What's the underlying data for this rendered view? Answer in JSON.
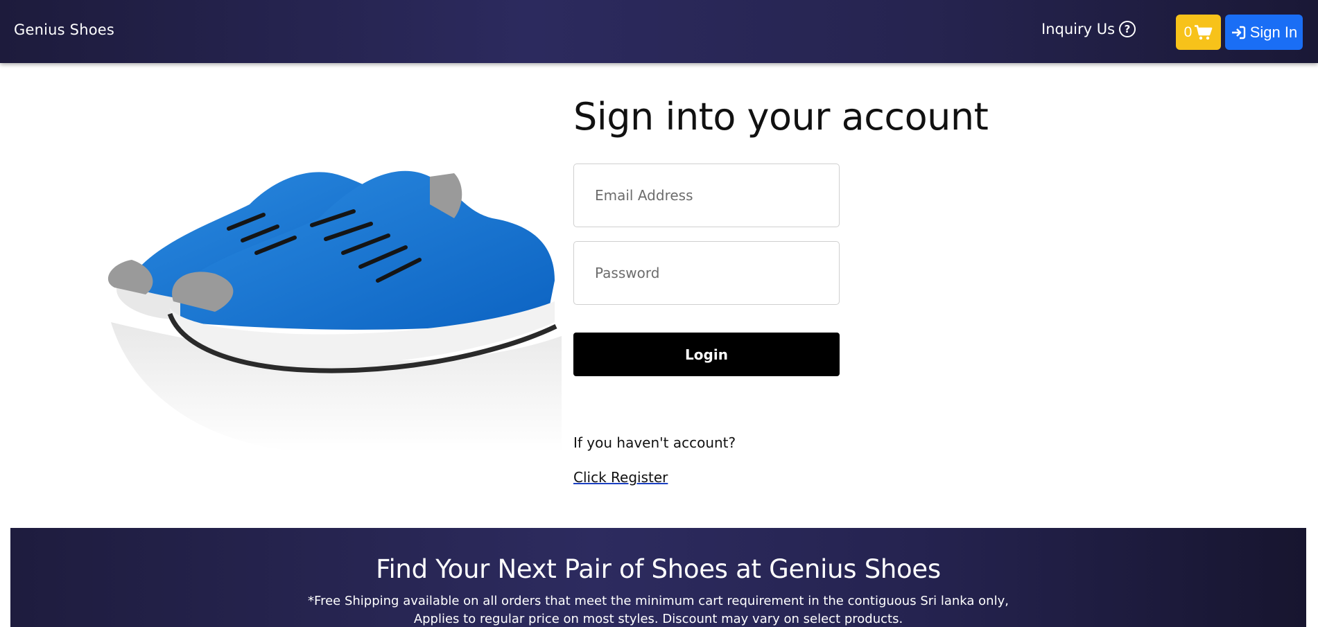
{
  "navbar": {
    "brand": "Genius Shoes",
    "inquiry_label": "Inquiry Us",
    "cart_count": "0",
    "signin_label": "Sign In",
    "colors": {
      "cart": "#f7c21a",
      "signin": "#1a6ef5",
      "nav_bg": "#2c2a5e"
    }
  },
  "login": {
    "title": "Sign into your account",
    "email_placeholder": "Email Address",
    "password_placeholder": "Password",
    "login_label": "Login",
    "no_account_text": "If you haven't account?",
    "register_link": "Click Register"
  },
  "banner": {
    "title": "Find Your Next Pair of Shoes at Genius Shoes",
    "line1": "*Free Shipping available on all orders that meet the minimum cart requirement in the contiguous Sri lanka only,",
    "line2": "Applies to regular price on most styles. Discount may vary on select products."
  },
  "icons": {
    "inquiry": "question-circle-icon",
    "cart": "shopping-cart-icon",
    "signin": "sign-in-icon"
  }
}
